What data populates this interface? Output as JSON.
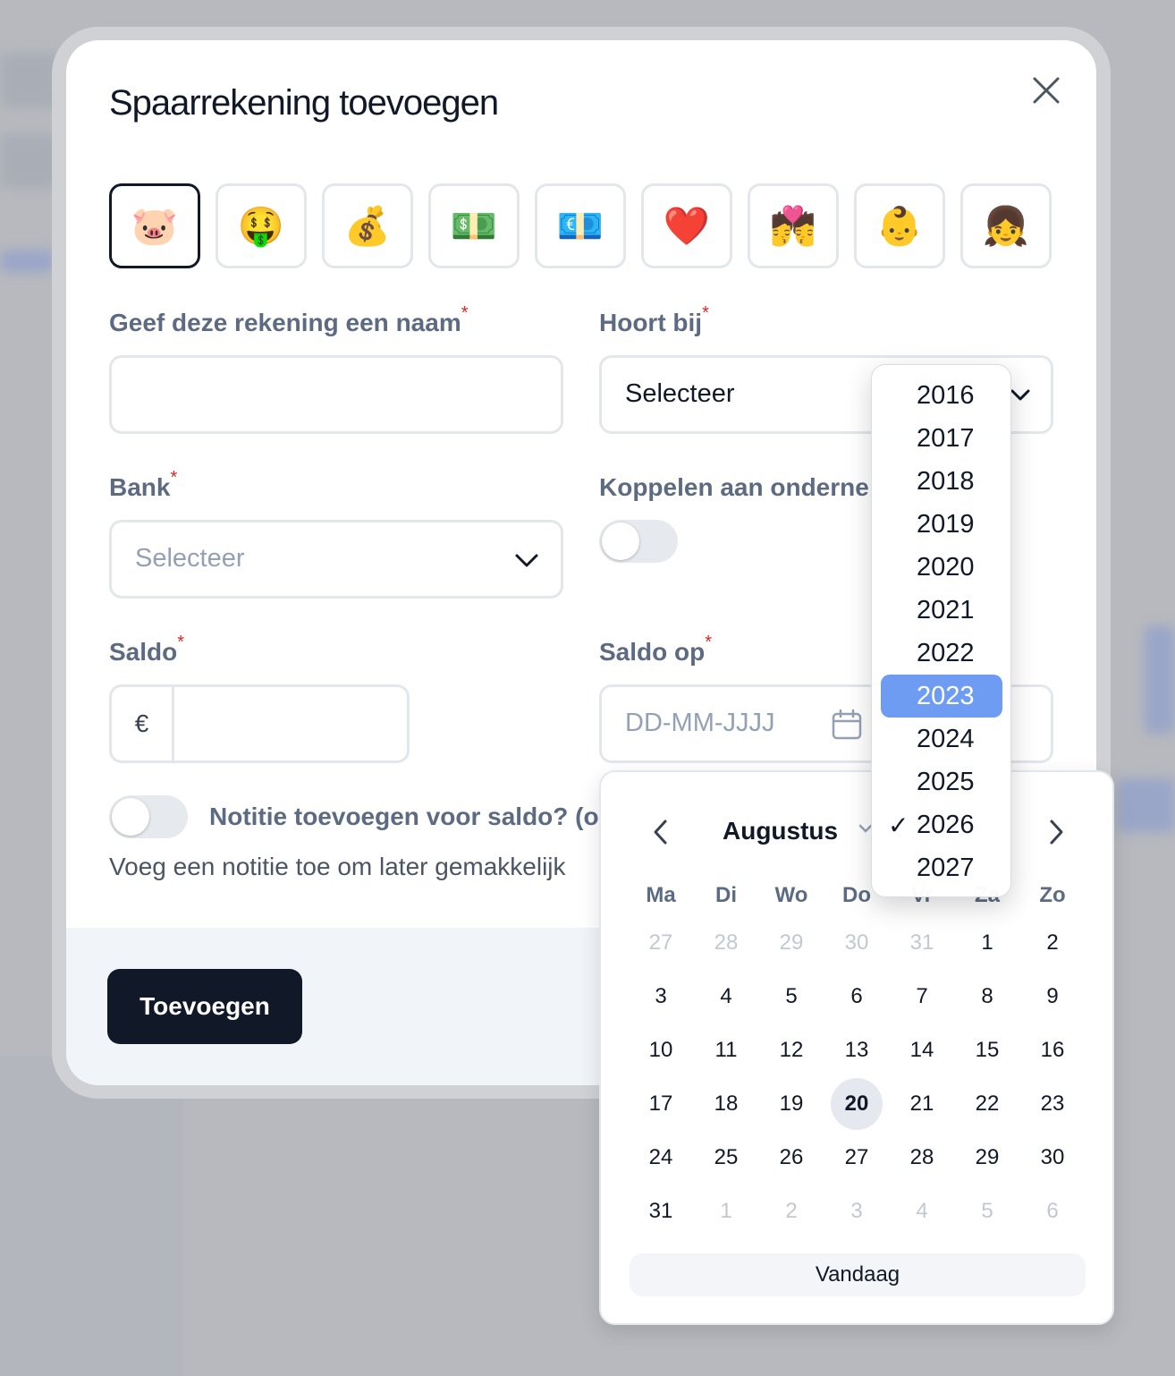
{
  "modal": {
    "title": "Spaarrekening toevoegen",
    "close_icon": "close-icon",
    "emojis": [
      "🐷",
      "🤑",
      "💰",
      "💵",
      "💶",
      "❤️",
      "💏",
      "👶",
      "👧"
    ],
    "selected_emoji_index": 0
  },
  "form": {
    "name_label": "Geef deze rekening een naam",
    "name_value": "",
    "belongs_label": "Hoort bij",
    "belongs_value": "Selecteer",
    "bank_label": "Bank",
    "bank_placeholder": "Selecteer",
    "link_label": "Koppelen aan onderne",
    "balance_label": "Saldo",
    "currency_symbol": "€",
    "balance_value": "",
    "balance_date_label": "Saldo op",
    "date_placeholder": "DD-MM-JJJJ",
    "required_mark": "*",
    "note_toggle_label": "Notitie toevoegen voor saldo? (o",
    "note_help": "Voeg een notitie toe om later gemakkelijk"
  },
  "footer": {
    "submit_label": "Toevoegen"
  },
  "calendar": {
    "month": "Augustus",
    "weekdays": [
      "Ma",
      "Di",
      "Wo",
      "Do",
      "Vr",
      "Za",
      "Zo"
    ],
    "weeks": [
      [
        {
          "d": "27",
          "m": 1
        },
        {
          "d": "28",
          "m": 1
        },
        {
          "d": "29",
          "m": 1
        },
        {
          "d": "30",
          "m": 1
        },
        {
          "d": "31",
          "m": 1
        },
        {
          "d": "1",
          "m": 0
        },
        {
          "d": "2",
          "m": 0
        }
      ],
      [
        {
          "d": "3",
          "m": 0
        },
        {
          "d": "4",
          "m": 0
        },
        {
          "d": "5",
          "m": 0
        },
        {
          "d": "6",
          "m": 0
        },
        {
          "d": "7",
          "m": 0
        },
        {
          "d": "8",
          "m": 0
        },
        {
          "d": "9",
          "m": 0
        }
      ],
      [
        {
          "d": "10",
          "m": 0
        },
        {
          "d": "11",
          "m": 0
        },
        {
          "d": "12",
          "m": 0
        },
        {
          "d": "13",
          "m": 0
        },
        {
          "d": "14",
          "m": 0
        },
        {
          "d": "15",
          "m": 0
        },
        {
          "d": "16",
          "m": 0
        }
      ],
      [
        {
          "d": "17",
          "m": 0
        },
        {
          "d": "18",
          "m": 0
        },
        {
          "d": "19",
          "m": 0
        },
        {
          "d": "20",
          "m": 0,
          "today": 1
        },
        {
          "d": "21",
          "m": 0
        },
        {
          "d": "22",
          "m": 0
        },
        {
          "d": "23",
          "m": 0
        }
      ],
      [
        {
          "d": "24",
          "m": 0
        },
        {
          "d": "25",
          "m": 0
        },
        {
          "d": "26",
          "m": 0
        },
        {
          "d": "27",
          "m": 0
        },
        {
          "d": "28",
          "m": 0
        },
        {
          "d": "29",
          "m": 0
        },
        {
          "d": "30",
          "m": 0
        }
      ],
      [
        {
          "d": "31",
          "m": 0
        },
        {
          "d": "1",
          "m": 1
        },
        {
          "d": "2",
          "m": 1
        },
        {
          "d": "3",
          "m": 1
        },
        {
          "d": "4",
          "m": 1
        },
        {
          "d": "5",
          "m": 1
        },
        {
          "d": "6",
          "m": 1
        }
      ]
    ],
    "today_button": "Vandaag"
  },
  "year_dropdown": {
    "years": [
      "2016",
      "2017",
      "2018",
      "2019",
      "2020",
      "2021",
      "2022",
      "2023",
      "2024",
      "2025",
      "2026",
      "2027"
    ],
    "highlighted": "2023",
    "checked": "2026",
    "check_mark": "✓"
  },
  "colors": {
    "primary_dark": "#111827",
    "label": "#5d6b82",
    "required": "#dc2626",
    "highlight": "#6f9cf3",
    "today_bg": "#e5e8ee"
  }
}
